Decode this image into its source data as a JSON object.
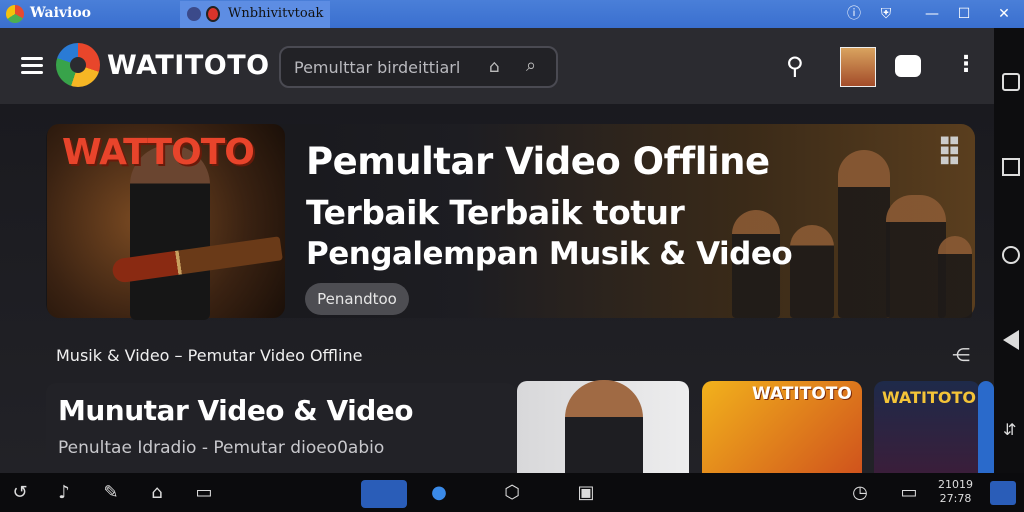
{
  "window": {
    "app_title": "Waivioo",
    "tab_title": "Wnbhivitvtoak",
    "controls": [
      "help-icon",
      "shield-icon",
      "minimize-icon",
      "maximize-icon",
      "close-icon"
    ]
  },
  "header": {
    "brand": "WATITOTO",
    "search_placeholder": "Pemulttar birdeittiarl"
  },
  "hero": {
    "thumb_title": "WATTOTO",
    "title": "Pemultar Video Offline",
    "subtitle_1": "Terbaik Terbaik totur",
    "subtitle_2": "Pengalempan Musik & Video",
    "button": "Penandtoo"
  },
  "section": {
    "title": "Musik & Video – Pemutar Video Offline"
  },
  "card": {
    "title": "Munutar Video & Video",
    "subtitle": "Penultae Idradio - Pemutar dioeo0abio"
  },
  "thumbnails": [
    {
      "label": ""
    },
    {
      "label": "WATITOTO"
    },
    {
      "label": "WATITOTO"
    }
  ],
  "taskbar": {
    "clock_line1": "21019",
    "clock_line2": "27:78"
  },
  "colors": {
    "title_bar": "#3a6fcf",
    "header_bg": "#2b2b30",
    "accent_red": "#e8442b",
    "taskbar": "#0b0b0d"
  }
}
